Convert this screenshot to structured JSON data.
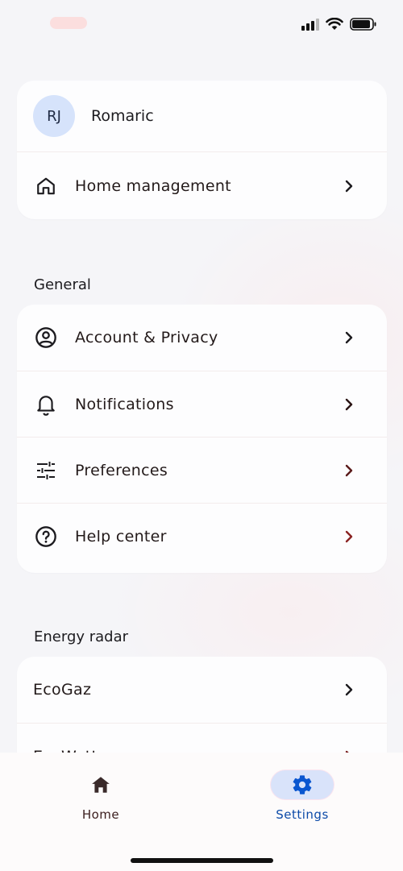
{
  "profile": {
    "initials": "RJ",
    "name": "Romaric"
  },
  "home_section": {
    "items": [
      {
        "label": "Home management",
        "icon": "home-outline-icon"
      }
    ]
  },
  "general": {
    "title": "General",
    "items": [
      {
        "label": "Account & Privacy",
        "icon": "account-circle-icon"
      },
      {
        "label": "Notifications",
        "icon": "bell-icon"
      },
      {
        "label": "Preferences",
        "icon": "sliders-icon"
      },
      {
        "label": "Help center",
        "icon": "help-circle-icon"
      }
    ]
  },
  "energy": {
    "title": "Energy radar",
    "items": [
      {
        "label": "EcoGaz"
      },
      {
        "label": "EcoWatt"
      }
    ]
  },
  "bottom_nav": {
    "home_label": "Home",
    "settings_label": "Settings"
  },
  "colors": {
    "accent": "#0b57d0",
    "active_pill": "#d9e3fa",
    "avatar_bg": "#d6e3fb",
    "chevron_red": "#7a1f1f"
  }
}
